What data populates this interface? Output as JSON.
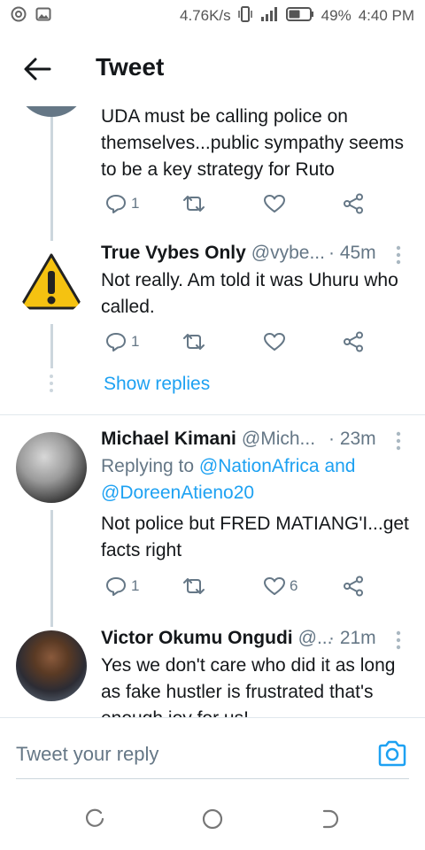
{
  "status_bar": {
    "speed": "4.76K/s",
    "battery": "49%",
    "time": "4:40 PM"
  },
  "header": {
    "title": "Tweet"
  },
  "tweets": [
    {
      "name": "",
      "handle": "",
      "time": "",
      "text": "UDA must be calling police on themselves...public sympathy seems to be a key strategy for Ruto",
      "replies": "1",
      "likes": ""
    },
    {
      "name": "True Vybes Only",
      "handle": "@vybe...",
      "time": "· 45m",
      "text": "Not really. Am told it was Uhuru who called.",
      "replies": "1",
      "likes": "",
      "show_replies": "Show replies"
    },
    {
      "name": "Michael Kimani",
      "handle": "@Mich...",
      "time": "· 23m",
      "replying_prefix": "Replying to",
      "replying_to_1": "@NationAfrica and",
      "replying_to_2": "@DoreenAtieno20",
      "text": "Not police but FRED MATIANG'I...get facts right",
      "replies": "1",
      "likes": "6"
    },
    {
      "name": "Victor Okumu Ongudi",
      "handle": "@...",
      "time": "· 21m",
      "text": "Yes we don't care who did it as long as fake hustler is frustrated that's enough joy for us!"
    }
  ],
  "reply_bar": {
    "placeholder": "Tweet your reply"
  },
  "colors": {
    "accent": "#1da1f2",
    "muted": "#657786",
    "warning": "#f5c211"
  }
}
